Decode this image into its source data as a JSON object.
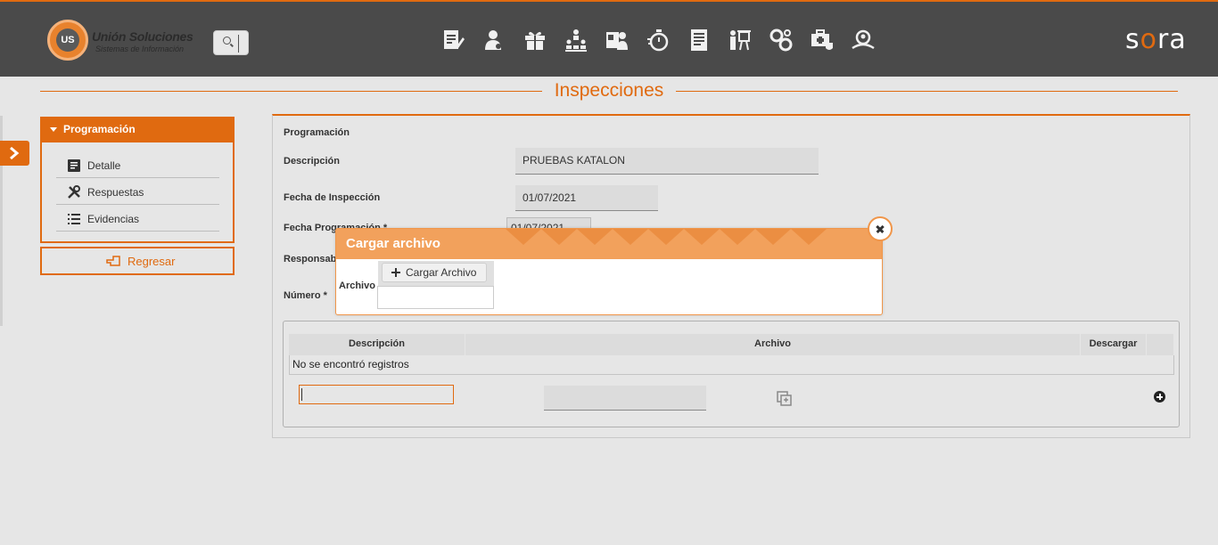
{
  "header": {
    "logo_main": "Unión Soluciones",
    "logo_sub": "Sistemas de Información",
    "logo_badge": "US",
    "brand": {
      "pre": "s",
      "accent": "o",
      "post": "ra"
    },
    "nav_icons": [
      "document-edit-icon",
      "user-icon",
      "gift-icon",
      "org-chart-icon",
      "user-id-icon",
      "stopwatch-icon",
      "report-icon",
      "presentation-icon",
      "gears-icon",
      "medical-kit-icon",
      "inspection-icon"
    ]
  },
  "page": {
    "title": "Inspecciones"
  },
  "menu": {
    "header": "Programación",
    "items": [
      {
        "label": "Detalle",
        "icon": "document-icon"
      },
      {
        "label": "Respuestas",
        "icon": "tools-icon"
      },
      {
        "label": "Evidencias",
        "icon": "list-icon"
      }
    ],
    "back": "Regresar"
  },
  "form": {
    "section": "Programación",
    "descripcion_label": "Descripción",
    "descripcion_value": "PRUEBAS KATALON",
    "fecha_insp_label": "Fecha de Inspección",
    "fecha_insp_value": "01/07/2021",
    "fecha_prog_label": "Fecha Programación *",
    "fecha_prog_value": "01/07/2021",
    "responsable_label": "Responsab",
    "numero_label": "Número *"
  },
  "table": {
    "columns": [
      "Descripción",
      "Archivo",
      "Descargar"
    ],
    "empty": "No se encontró registros"
  },
  "dialog": {
    "title": "Cargar archivo",
    "field_label": "Archivo",
    "button": "Cargar Archivo"
  },
  "colors": {
    "accent": "#e06a10",
    "topbar": "#4a4a4a",
    "dialog_head": "#f2a15c"
  }
}
